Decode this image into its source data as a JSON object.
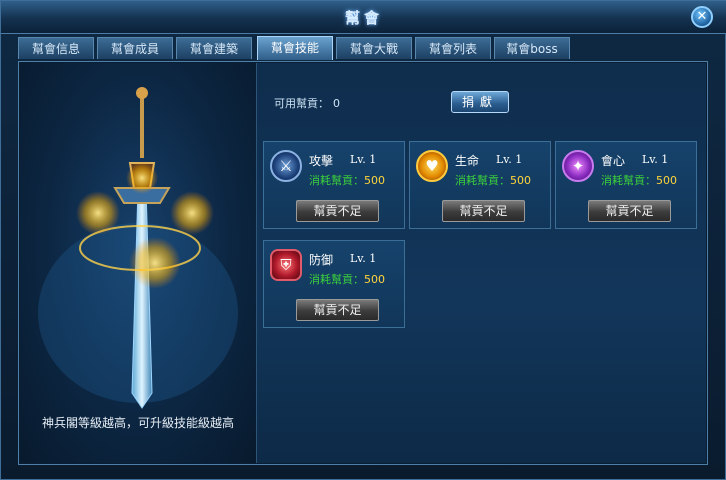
{
  "window": {
    "title": "幫會",
    "close_glyph": "✕"
  },
  "tabs": [
    {
      "label": "幫會信息",
      "active": false
    },
    {
      "label": "幫會成員",
      "active": false
    },
    {
      "label": "幫會建築",
      "active": false
    },
    {
      "label": "幫會技能",
      "active": true
    },
    {
      "label": "幫會大戰",
      "active": false
    },
    {
      "label": "幫會列表",
      "active": false
    },
    {
      "label": "幫會boss",
      "active": false
    }
  ],
  "left_panel": {
    "caption": "神兵閣等級越高，可升級技能級越高"
  },
  "points": {
    "label": "可用幫貢：",
    "value": "0"
  },
  "donate_button": "捐獻",
  "skills": [
    {
      "name": "攻擊",
      "level": "Lv. 1",
      "cost_label": "消耗幫貢：",
      "cost_value": "500",
      "button": "幫貢不足",
      "icon": "sword-icon"
    },
    {
      "name": "生命",
      "level": "Lv. 1",
      "cost_label": "消耗幫貢：",
      "cost_value": "500",
      "button": "幫貢不足",
      "icon": "heart-icon"
    },
    {
      "name": "會心",
      "level": "Lv. 1",
      "cost_label": "消耗幫貢：",
      "cost_value": "500",
      "button": "幫貢不足",
      "icon": "blade-icon"
    },
    {
      "name": "防御",
      "level": "Lv. 1",
      "cost_label": "消耗幫貢：",
      "cost_value": "500",
      "button": "幫貢不足",
      "icon": "shield-icon"
    }
  ]
}
